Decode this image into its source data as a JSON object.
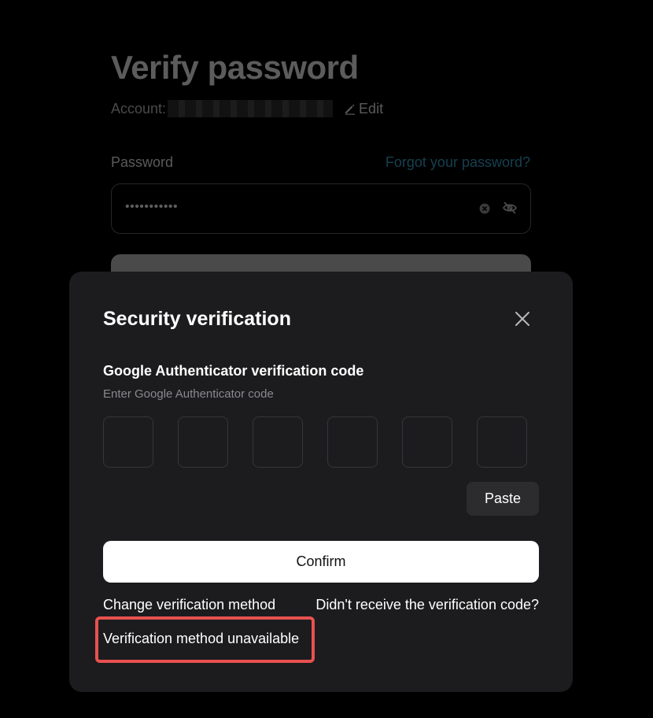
{
  "background": {
    "page_title": "Verify password",
    "account_label": "Account:",
    "edit_label": "Edit",
    "password_label": "Password",
    "forgot_link": "Forgot your password?",
    "password_value": "•••••••••••",
    "icons": [
      "pencil-icon",
      "clear-icon",
      "eye-off-icon"
    ]
  },
  "modal": {
    "title": "Security verification",
    "field_title": "Google Authenticator verification code",
    "field_subtitle": "Enter Google Authenticator code",
    "code_digits": [
      "",
      "",
      "",
      "",
      "",
      ""
    ],
    "paste_label": "Paste",
    "confirm_label": "Confirm",
    "change_method_link": "Change verification method",
    "not_received_link": "Didn't receive the verification code?",
    "unavailable_link": "Verification method unavailable",
    "icons": [
      "close-icon"
    ]
  },
  "colors": {
    "modal_bg": "#1c1c1e",
    "confirm_bg": "#ffffff",
    "highlight": "#e8514f",
    "link_accent": "#16404f"
  }
}
